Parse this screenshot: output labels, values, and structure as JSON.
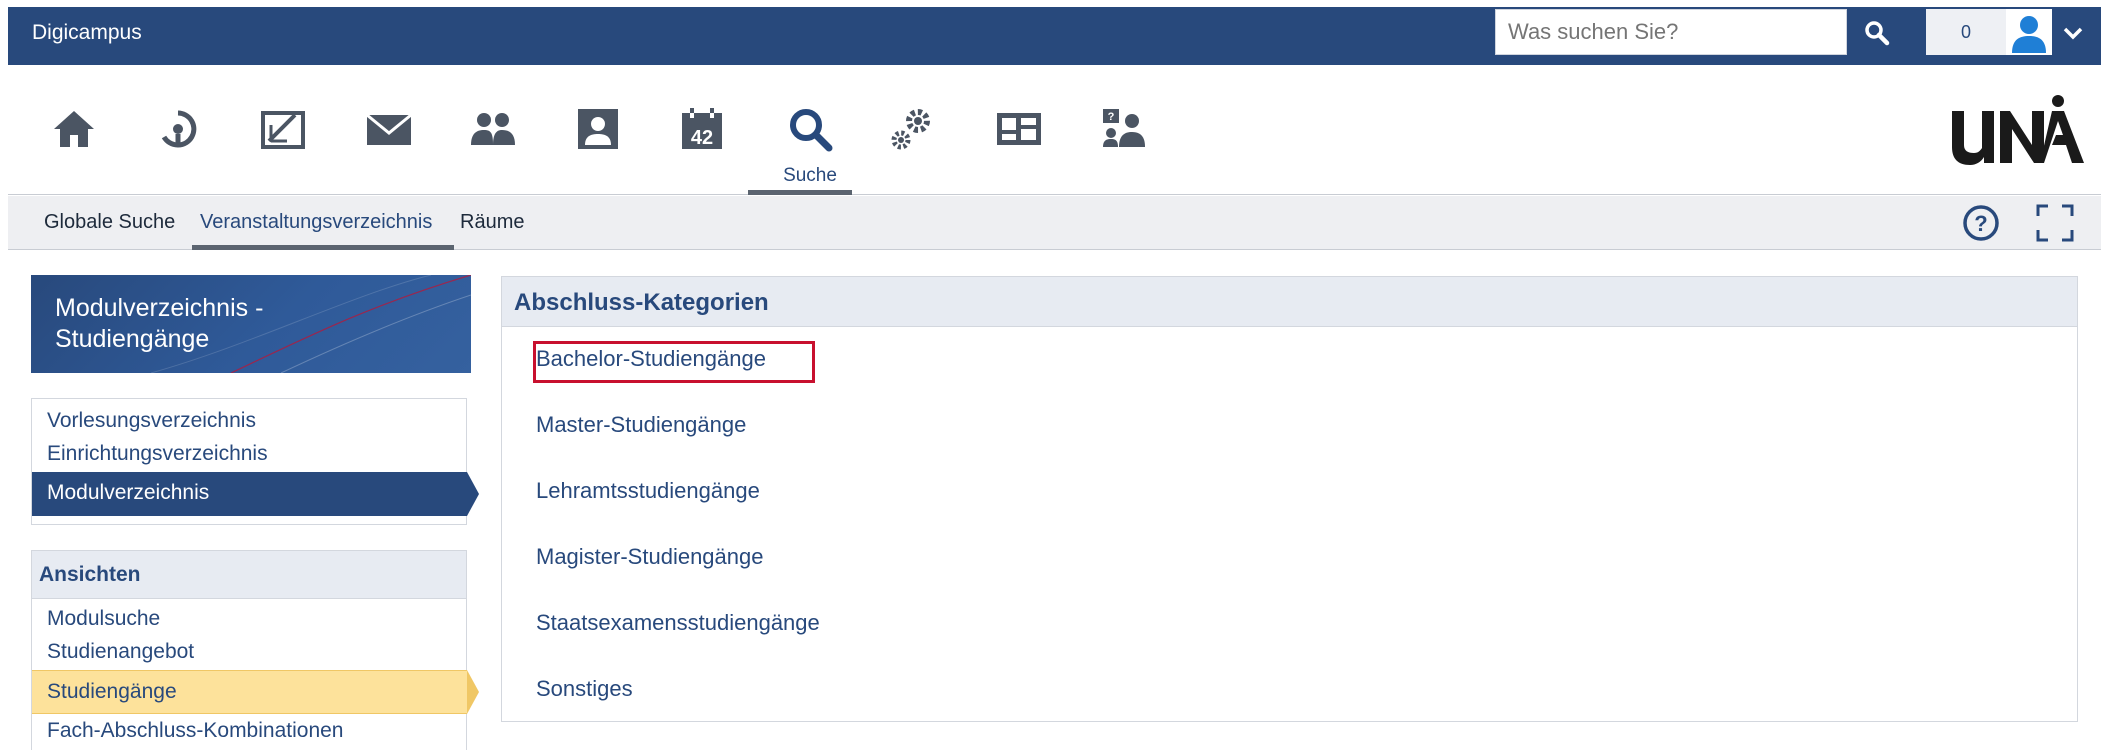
{
  "app": {
    "title": "Digicampus"
  },
  "search": {
    "placeholder": "Was suchen Sie?"
  },
  "header": {
    "notification_count": "0"
  },
  "icon_nav": {
    "items": [
      {
        "icon": "home-icon"
      },
      {
        "icon": "compass-icon"
      },
      {
        "icon": "courses-icon"
      },
      {
        "icon": "mail-icon"
      },
      {
        "icon": "community-icon"
      },
      {
        "icon": "profile-icon"
      },
      {
        "icon": "calendar-icon",
        "text": "42"
      },
      {
        "icon": "search-icon",
        "label": "Suche",
        "active": true
      },
      {
        "icon": "tools-icon"
      },
      {
        "icon": "browse-icon"
      },
      {
        "icon": "admin-icon"
      }
    ]
  },
  "tabs": [
    {
      "label": "Globale Suche"
    },
    {
      "label": "Veranstaltungsverzeichnis",
      "active": true
    },
    {
      "label": "Räume"
    }
  ],
  "sidebar": {
    "header_title": "Modulverzeichnis - Studiengänge",
    "nav_links": [
      {
        "label": "Vorlesungsverzeichnis"
      },
      {
        "label": "Einrichtungsverzeichnis"
      },
      {
        "label": "Modulverzeichnis",
        "selected": true
      }
    ],
    "views_title": "Ansichten",
    "views": [
      {
        "label": "Modulsuche"
      },
      {
        "label": "Studienangebot"
      },
      {
        "label": "Studiengänge",
        "highlighted": true
      },
      {
        "label": "Fach-Abschluss-Kombinationen"
      }
    ]
  },
  "main": {
    "title": "Abschluss-Kategorien",
    "categories": [
      "Bachelor-Studiengänge",
      "Master-Studiengänge",
      "Lehramtsstudiengänge",
      "Magister-Studiengänge",
      "Staatsexamensstudiengänge",
      "Sonstiges"
    ]
  },
  "colors": {
    "primary": "#28497c",
    "highlight": "#fde29b",
    "annotation": "#c8102e",
    "icon": "#4b5563"
  }
}
